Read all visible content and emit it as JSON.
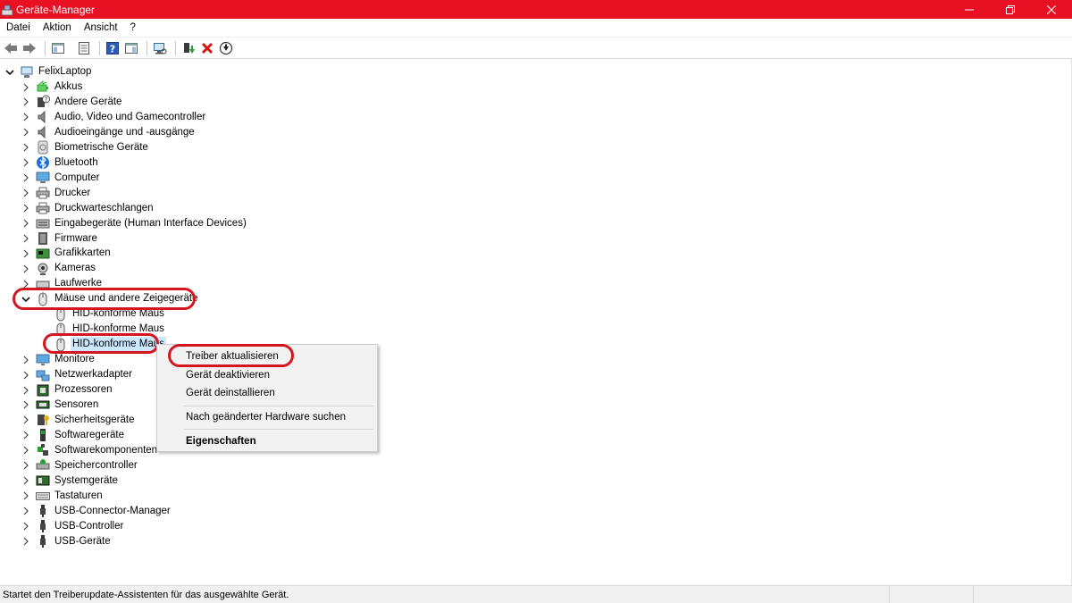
{
  "window": {
    "title": "Geräte-Manager",
    "accent_color": "#e81123",
    "controls": [
      "minimize",
      "restore",
      "close"
    ]
  },
  "menubar": {
    "items": [
      "Datei",
      "Aktion",
      "Ansicht",
      "?"
    ]
  },
  "toolbar": {
    "buttons": [
      "back-arrow-icon",
      "forward-arrow-icon",
      "show-hide-console-icon",
      "properties-icon",
      "help-icon",
      "action-pane-icon",
      "scan-hardware-icon",
      "update-driver-icon",
      "uninstall-icon",
      "disable-icon"
    ]
  },
  "tree": {
    "root": "FelixLaptop",
    "categories": [
      {
        "label": "Akkus",
        "icon": "battery-icon"
      },
      {
        "label": "Andere Geräte",
        "icon": "unknown-device-icon"
      },
      {
        "label": "Audio, Video und Gamecontroller",
        "icon": "speaker-icon"
      },
      {
        "label": "Audioeingänge und -ausgänge",
        "icon": "speaker-icon"
      },
      {
        "label": "Biometrische Geräte",
        "icon": "fingerprint-icon"
      },
      {
        "label": "Bluetooth",
        "icon": "bluetooth-icon"
      },
      {
        "label": "Computer",
        "icon": "computer-icon"
      },
      {
        "label": "Drucker",
        "icon": "printer-icon"
      },
      {
        "label": "Druckwarteschlangen",
        "icon": "printer-icon"
      },
      {
        "label": "Eingabegeräte (Human Interface Devices)",
        "icon": "hid-icon"
      },
      {
        "label": "Firmware",
        "icon": "firmware-icon"
      },
      {
        "label": "Grafikkarten",
        "icon": "display-adapter-icon"
      },
      {
        "label": "Kameras",
        "icon": "camera-icon"
      },
      {
        "label": "Laufwerke",
        "icon": "drive-icon"
      },
      {
        "label": "Mäuse und andere Zeigegeräte",
        "icon": "mouse-icon"
      },
      {
        "label": "Monitore",
        "icon": "monitor-icon"
      },
      {
        "label": "Netzwerkadapter",
        "icon": "network-icon"
      },
      {
        "label": "Prozessoren",
        "icon": "processor-icon"
      },
      {
        "label": "Sensoren",
        "icon": "sensor-icon"
      },
      {
        "label": "Sicherheitsgeräte",
        "icon": "security-key-icon"
      },
      {
        "label": "Softwaregeräte",
        "icon": "software-device-icon"
      },
      {
        "label": "Softwarekomponenten",
        "icon": "puzzle-icon"
      },
      {
        "label": "Speichercontroller",
        "icon": "storage-controller-icon"
      },
      {
        "label": "Systemgeräte",
        "icon": "system-device-icon"
      },
      {
        "label": "Tastaturen",
        "icon": "keyboard-icon"
      },
      {
        "label": "USB-Connector-Manager",
        "icon": "usb-icon"
      },
      {
        "label": "USB-Controller",
        "icon": "usb-icon"
      },
      {
        "label": "USB-Geräte",
        "icon": "usb-icon"
      }
    ],
    "expanded_category": "Mäuse und andere Zeigegeräte",
    "mouse_children": [
      "HID-konforme Maus",
      "HID-konforme Maus",
      "HID-konforme Maus"
    ],
    "selected_child_index": 2,
    "selection_color": "#cce8ff"
  },
  "context_menu": {
    "items": [
      {
        "label": "Treiber aktualisieren",
        "bold": false
      },
      {
        "label": "Gerät deaktivieren",
        "bold": false
      },
      {
        "label": "Gerät deinstallieren",
        "bold": false
      },
      {
        "label": "Nach geänderter Hardware suchen",
        "bold": false
      },
      {
        "label": "Eigenschaften",
        "bold": true
      }
    ]
  },
  "annotation_color": "#d4141e",
  "statusbar": {
    "text": "Startet den Treiberupdate-Assistenten für das ausgewählte Gerät."
  }
}
